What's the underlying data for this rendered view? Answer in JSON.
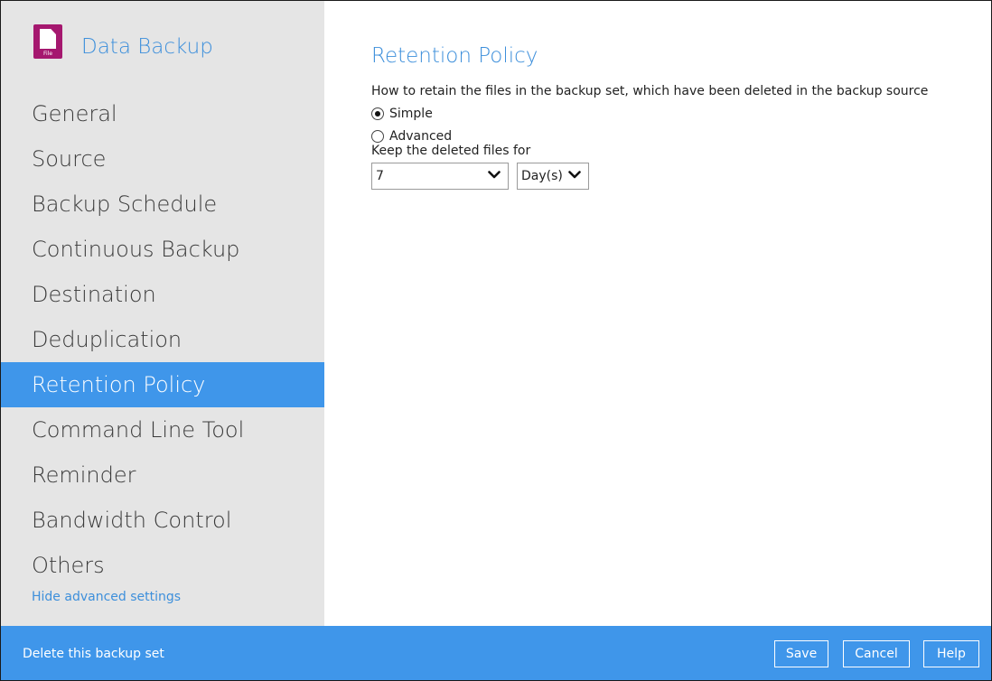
{
  "app": {
    "title": "Data Backup",
    "icon_name": "file-icon",
    "icon_label": "File",
    "icon_color": "#a5186f"
  },
  "sidebar": {
    "items": [
      {
        "label": "General",
        "active": false
      },
      {
        "label": "Source",
        "active": false
      },
      {
        "label": "Backup Schedule",
        "active": false
      },
      {
        "label": "Continuous Backup",
        "active": false
      },
      {
        "label": "Destination",
        "active": false
      },
      {
        "label": "Deduplication",
        "active": false
      },
      {
        "label": "Retention Policy",
        "active": true
      },
      {
        "label": "Command Line Tool",
        "active": false
      },
      {
        "label": "Reminder",
        "active": false
      },
      {
        "label": "Bandwidth Control",
        "active": false
      },
      {
        "label": "Others",
        "active": false
      }
    ],
    "hide_advanced_label": "Hide advanced settings"
  },
  "main": {
    "title": "Retention Policy",
    "description": "How to retain the files in the backup set, which have been deleted in the backup source",
    "options": [
      {
        "label": "Simple",
        "checked": true
      },
      {
        "label": "Advanced",
        "checked": false
      }
    ],
    "keep_label": "Keep the deleted files for",
    "keep_value": "7",
    "keep_unit": "Day(s)"
  },
  "footer": {
    "delete_label": "Delete this backup set",
    "save_label": "Save",
    "cancel_label": "Cancel",
    "help_label": "Help"
  },
  "colors": {
    "accent": "#3f96ea",
    "title_blue": "#3d8fdb",
    "sidebar_bg": "#e5e5e5"
  }
}
